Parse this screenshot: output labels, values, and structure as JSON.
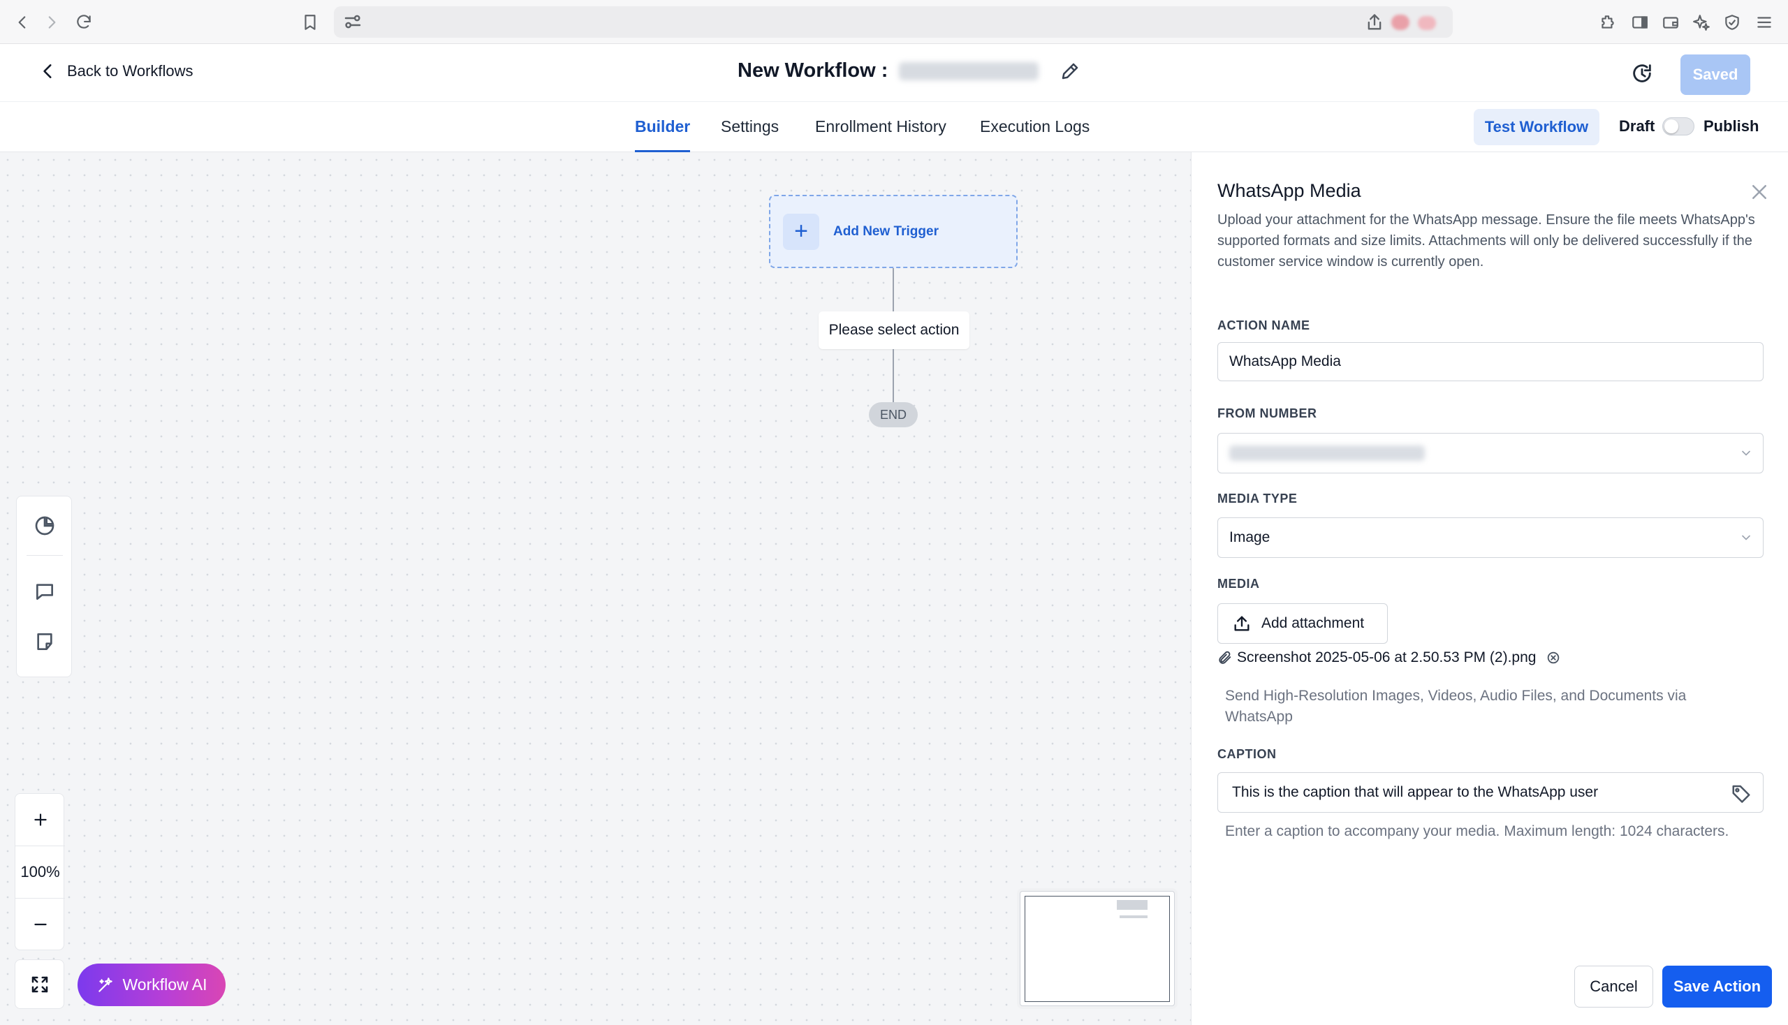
{
  "header": {
    "back_label": "Back to Workflows",
    "title_prefix": "New Workflow :",
    "saved_label": "Saved"
  },
  "tabs": [
    {
      "label": "Builder",
      "active": true
    },
    {
      "label": "Settings",
      "active": false
    },
    {
      "label": "Enrollment History",
      "active": false
    },
    {
      "label": "Execution Logs",
      "active": false
    }
  ],
  "actions": {
    "test_label": "Test Workflow",
    "draft_label": "Draft",
    "publish_label": "Publish",
    "published": false
  },
  "canvas": {
    "trigger_label": "Add New Trigger",
    "action_placeholder": "Please select action",
    "end_label": "END",
    "zoom_level": "100%",
    "ai_label": "Workflow AI"
  },
  "panel": {
    "title": "WhatsApp Media",
    "description": "Upload your attachment for the WhatsApp message. Ensure the file meets WhatsApp's supported formats and size limits. Attachments will only be delivered successfully if the customer service window is currently open.",
    "action_name_label": "ACTION NAME",
    "action_name_value": "WhatsApp Media",
    "from_number_label": "FROM NUMBER",
    "media_type_label": "MEDIA TYPE",
    "media_type_value": "Image",
    "media_label": "MEDIA",
    "attach_label": "Add attachment",
    "file_name": "Screenshot 2025-05-06 at 2.50.53 PM (2).png",
    "media_help_line1": "Send High-Resolution Images, Videos, Audio Files, and Documents via",
    "media_help_line2": "WhatsApp",
    "caption_label": "CAPTION",
    "caption_value": "This is the caption that will appear to the WhatsApp user",
    "caption_help": "Enter a caption to accompany your media. Maximum length: 1024 characters.",
    "cancel_label": "Cancel",
    "save_label": "Save Action"
  },
  "colors": {
    "accent": "#1f5fd1",
    "primary_button": "#155eef",
    "ai_gradient_start": "#7c3aed",
    "ai_gradient_end": "#d946b4"
  }
}
